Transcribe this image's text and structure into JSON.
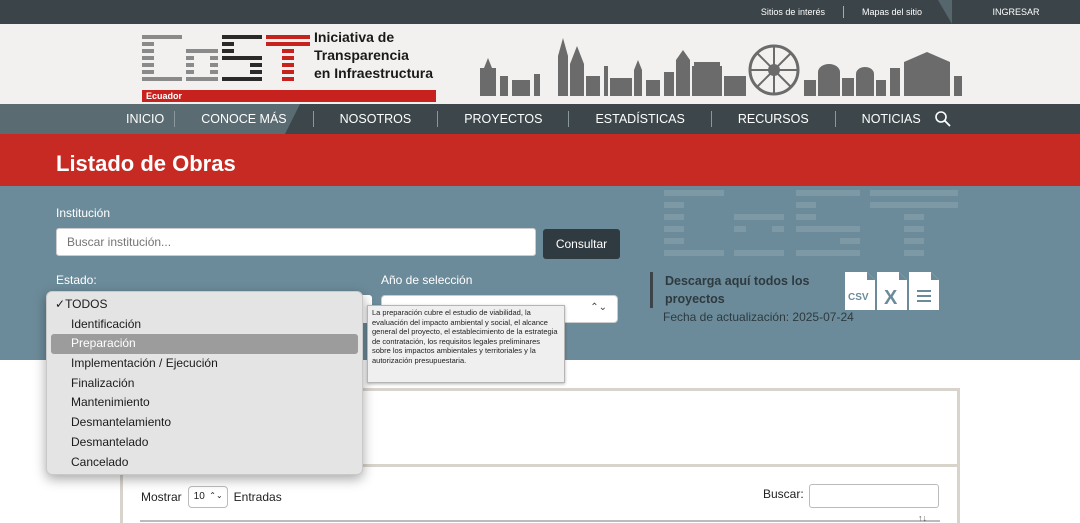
{
  "topbar": {
    "sitios": "Sitios de interés",
    "mapas": "Mapas del sitio",
    "ingresar": "INGRESAR"
  },
  "header": {
    "logo_text": "CoST",
    "country_tag": "Ecuador",
    "brand_line1": "Iniciativa de",
    "brand_line2": "Transparencia",
    "brand_line3": "en Infraestructura"
  },
  "nav": {
    "items": [
      "INICIO",
      "CONOCE MÁS",
      "NOSOTROS",
      "PROYECTOS",
      "ESTADÍSTICAS",
      "RECURSOS",
      "NOTICIAS"
    ]
  },
  "page": {
    "title": "Listado de Obras"
  },
  "filters": {
    "institucion_label": "Institución",
    "institucion_placeholder": "Buscar institución...",
    "consultar_label": "Consultar",
    "estado_label": "Estado:",
    "anio_label": "Año de selección",
    "anio_value": "",
    "download_title": "Descarga aquí todos los proyectos",
    "update_date": "Fecha de actualización: 2025-07-24",
    "file_icons": [
      "csv-file-icon",
      "excel-file-icon",
      "text-file-icon"
    ],
    "csv_text": "CSV",
    "x_text": "X"
  },
  "dropdown": {
    "items": [
      {
        "label": "TODOS",
        "checked": true
      },
      {
        "label": "Identificación"
      },
      {
        "label": "Preparación",
        "highlighted": true
      },
      {
        "label": "Implementación / Ejecución"
      },
      {
        "label": "Finalización"
      },
      {
        "label": "Mantenimiento"
      },
      {
        "label": "Desmantelamiento"
      },
      {
        "label": "Desmantelado"
      },
      {
        "label": "Cancelado"
      }
    ],
    "check_mark": "✓"
  },
  "tooltip": {
    "text": "La preparación cubre el estudio de viabilidad, la evaluación del impacto ambiental y social, el alcance general del proyecto, el establecimiento de la estrategia de contratación, los requisitos legales preliminares sobre los impactos ambientales y territoriales y la autorización presupuestaria."
  },
  "table": {
    "mostrar_label": "Mostrar",
    "entries_value": "10",
    "entradas_label": "Entradas",
    "buscar_label": "Buscar:"
  },
  "colors": {
    "topbar": "#3b4448",
    "nav": "#3d474b",
    "title_red": "#c62a23",
    "filter_bg": "#6c8b9a",
    "brand_red": "#c8221f"
  }
}
